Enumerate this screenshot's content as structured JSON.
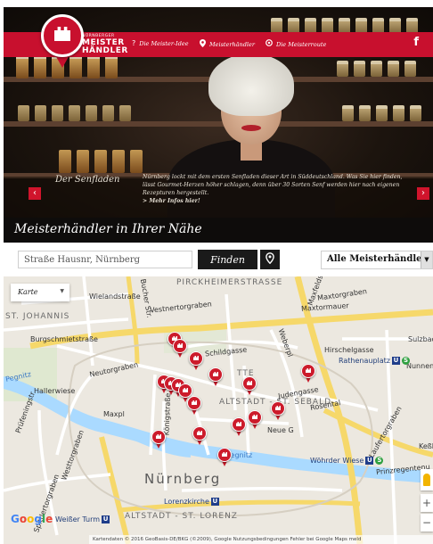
{
  "brand": {
    "logo_small": "NÜRNBERGER",
    "logo_line1": "MEISTER",
    "logo_line2": "HÄNDLER"
  },
  "nav": {
    "items": [
      {
        "label": "Die Meister-Idee",
        "icon": "question-icon"
      },
      {
        "label": "Meisterhändler",
        "icon": "map-pin-icon"
      },
      {
        "label": "Die Meisterroute",
        "icon": "route-pin-icon"
      }
    ],
    "facebook": "f"
  },
  "hero": {
    "caption_title": "Der Senfladen",
    "caption_text": "Nürnberg lockt mit dem ersten Senfladen dieser Art in Süddeutschland. Was Sie hier finden, lässt Gourmet-Herzen höher schlagen, denn über 30 Sorten Senf werden hier nach eigenen Rezepturen hergestellt.",
    "caption_link": "> Mehr Infos hier!",
    "prev": "‹",
    "next": "›"
  },
  "section": {
    "title": "Meisterhändler in Ihrer Nähe"
  },
  "search": {
    "placeholder": "Straße Hausnr, Nürnberg",
    "find_label": "Finden",
    "filter_value": "Alle Meisterhändler",
    "filter_arrow": "▼"
  },
  "map": {
    "type_label": "Karte",
    "type_arrow": "▼",
    "streets": [
      "Wielandstraße",
      "Vestnertorgraben",
      "Maxtorgraben",
      "Maxtormauer",
      "Burgschmietstraße",
      "Schildgasse",
      "Hirschelgasse",
      "Neutorgraben",
      "Hallerwiese",
      "Pegnitz",
      "Judengasse",
      "Rosental",
      "Maxpl",
      "Neue G",
      "Prinzregentenu",
      "Spittlertorgraben",
      "Westtorgraben",
      "Pirckheimerstraße",
      "Bucher Str.",
      "Maxfeldstr",
      "Weberpl",
      "Laufertorgraben",
      "Sulzbac",
      "Nunnen",
      "Keßl",
      "Prüfeningstr",
      "Königstraße",
      "Pegnitz"
    ],
    "districts": [
      "ST. JOHANNIS",
      "PIRCKHEIMERSTRASSE",
      "ALTSTADT - ST. SEBALD",
      "ALTSTADT - ST. LORENZ",
      "TTE"
    ],
    "big_label": "Nürnberg",
    "transit": [
      {
        "label": "Rathenauplatz",
        "badges": [
          "U",
          "S"
        ]
      },
      {
        "label": "Wöhrder Wiese",
        "badges": [
          "U",
          "S"
        ]
      },
      {
        "label": "Lorenzkirche",
        "badges": [
          "U"
        ]
      },
      {
        "label": "Weißer Turm",
        "badges": [
          "U"
        ]
      }
    ],
    "zoom_in": "+",
    "zoom_out": "−",
    "attribution": "Kartendaten © 2016 GeoBasis-DE/BKG (©2009), Google    Nutzungsbedingungen    Fehler bei Google Maps meld",
    "google": {
      "G": "G",
      "o1": "o",
      "o2": "o",
      "g": "g",
      "l": "l",
      "e": "e"
    },
    "colors": {
      "marker": "#cc1b2b",
      "water": "#aadaff",
      "road": "#ffffff",
      "yellow_road": "#f6d86a"
    }
  },
  "colors": {
    "brand_red": "#c8102e",
    "dark": "#0e0c0b"
  }
}
